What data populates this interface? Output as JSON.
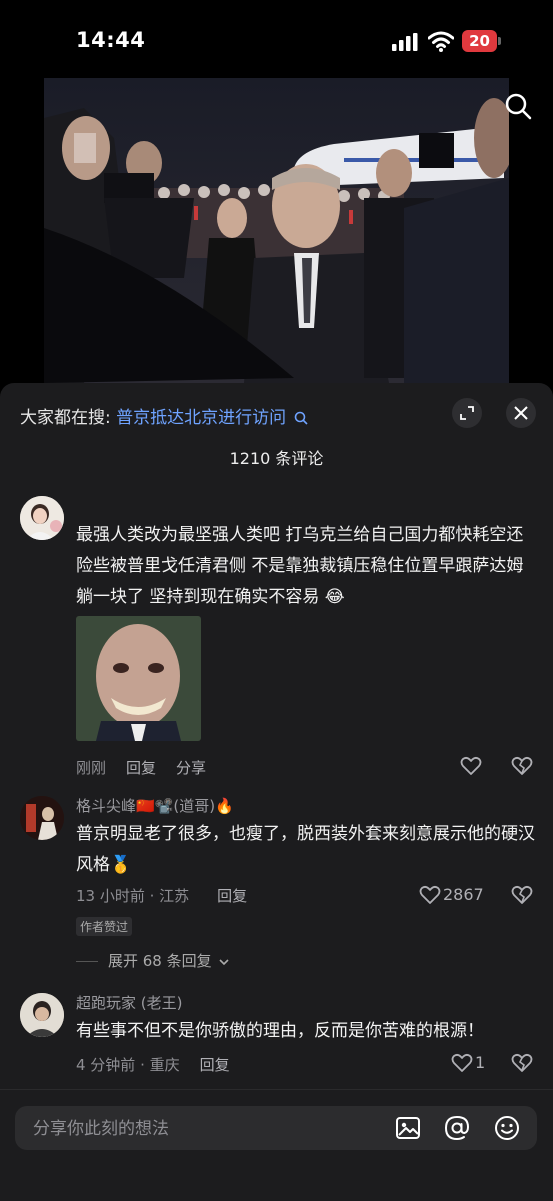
{
  "status_bar": {
    "time": "14:44",
    "battery": "20"
  },
  "search_bar": {
    "prefix": "大家都在搜:",
    "term": "普京抵达北京进行访问"
  },
  "comments_header": {
    "count_label": "1210 条评论"
  },
  "comments": [
    {
      "username": "",
      "text": "最强人类改为最坚强人类吧 打乌克兰给自己国力都快耗空还险些被普里戈任清君侧 不是靠独裁镇压稳住位置早跟萨达姆躺一块了 坚持到现在确实不容易 😂",
      "time": "刚刚",
      "reply_label": "回复",
      "share_label": "分享"
    },
    {
      "username": "格斗尖峰🇨🇳📽️(道哥)🔥",
      "text": "普京明显老了很多，也瘦了，脱西装外套来刻意展示他的硬汉风格🥇",
      "time": "13 小时前 · 江苏",
      "reply_label": "回复",
      "likes": "2867",
      "badge": "作者赞过",
      "expand_label": "展开 68 条回复"
    },
    {
      "username": "超跑玩家 (老王)",
      "text": "有些事不但不是你骄傲的理由，反而是你苦难的根源！",
      "time": "4 分钟前 · 重庆",
      "reply_label": "回复",
      "likes": "1"
    }
  ],
  "input": {
    "placeholder": "分享你此刻的想法"
  },
  "colors": {
    "sheet_bg": "#1c1c1e",
    "link_blue": "#6fa3ff",
    "battery_red": "#e0393e"
  }
}
